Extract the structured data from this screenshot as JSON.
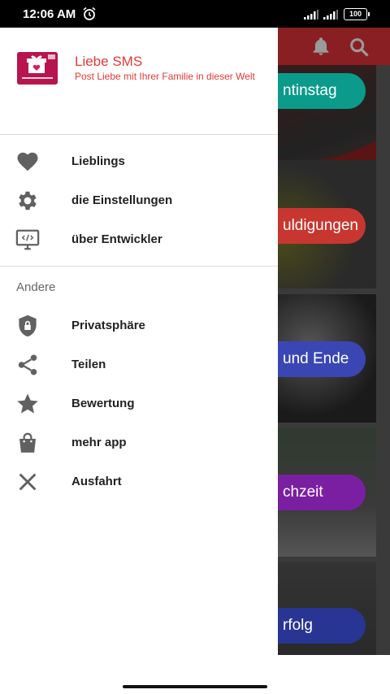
{
  "status": {
    "time": "12:06 AM",
    "battery": "100",
    "icons": [
      "alarm-icon",
      "signal-icon",
      "signal-icon",
      "battery-icon"
    ]
  },
  "background_app": {
    "toolbar_icons": [
      "bell-icon",
      "search-icon"
    ],
    "cards": [
      {
        "label": "ntinstag",
        "pill_color": "#0b9b8a"
      },
      {
        "label": "uldigungen",
        "pill_color": "#c7372f"
      },
      {
        "label": "und Ende",
        "pill_color": "#3a46b4"
      },
      {
        "label": "chzeit",
        "pill_color": "#7b1fa2"
      },
      {
        "label": "rfolg",
        "pill_color": "#283593"
      }
    ]
  },
  "drawer": {
    "app_title": "Liebe SMS",
    "app_subtitle": "Post Liebe mit Ihrer Familie in dieser Welt",
    "accent": "#e53935",
    "items": [
      {
        "label": "Lieblings",
        "icon": "heart-icon"
      },
      {
        "label": "die Einstellungen",
        "icon": "gear-icon"
      },
      {
        "label": "über Entwickler",
        "icon": "monitor-code-icon"
      }
    ],
    "section_title": "Andere",
    "other_items": [
      {
        "label": "Privatsphäre",
        "icon": "shield-lock-icon"
      },
      {
        "label": "Teilen",
        "icon": "share-icon"
      },
      {
        "label": "Bewertung",
        "icon": "star-icon"
      },
      {
        "label": "mehr app",
        "icon": "shopping-bag-icon"
      },
      {
        "label": "Ausfahrt",
        "icon": "close-icon"
      }
    ]
  }
}
